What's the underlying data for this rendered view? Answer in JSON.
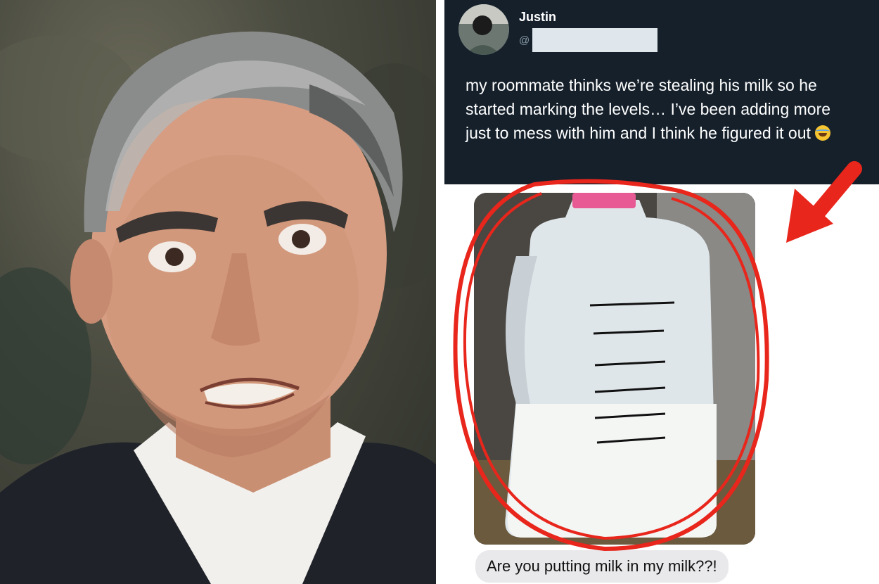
{
  "tweet": {
    "author_name": "Justin",
    "handle_prefix": "@",
    "text": "my roommate thinks we’re stealing his milk so he started marking the levels… I’ve been adding more just to mess with him and I think he figured it out",
    "emoji": "tears-of-joy-emoji"
  },
  "message": {
    "text": "Are you putting milk in my milk??!"
  },
  "annotations": {
    "circle_color": "#e8261c",
    "arrow_color": "#e8261c"
  },
  "colors": {
    "tweet_background": "#15202b",
    "bubble_background": "#e9e9eb"
  }
}
